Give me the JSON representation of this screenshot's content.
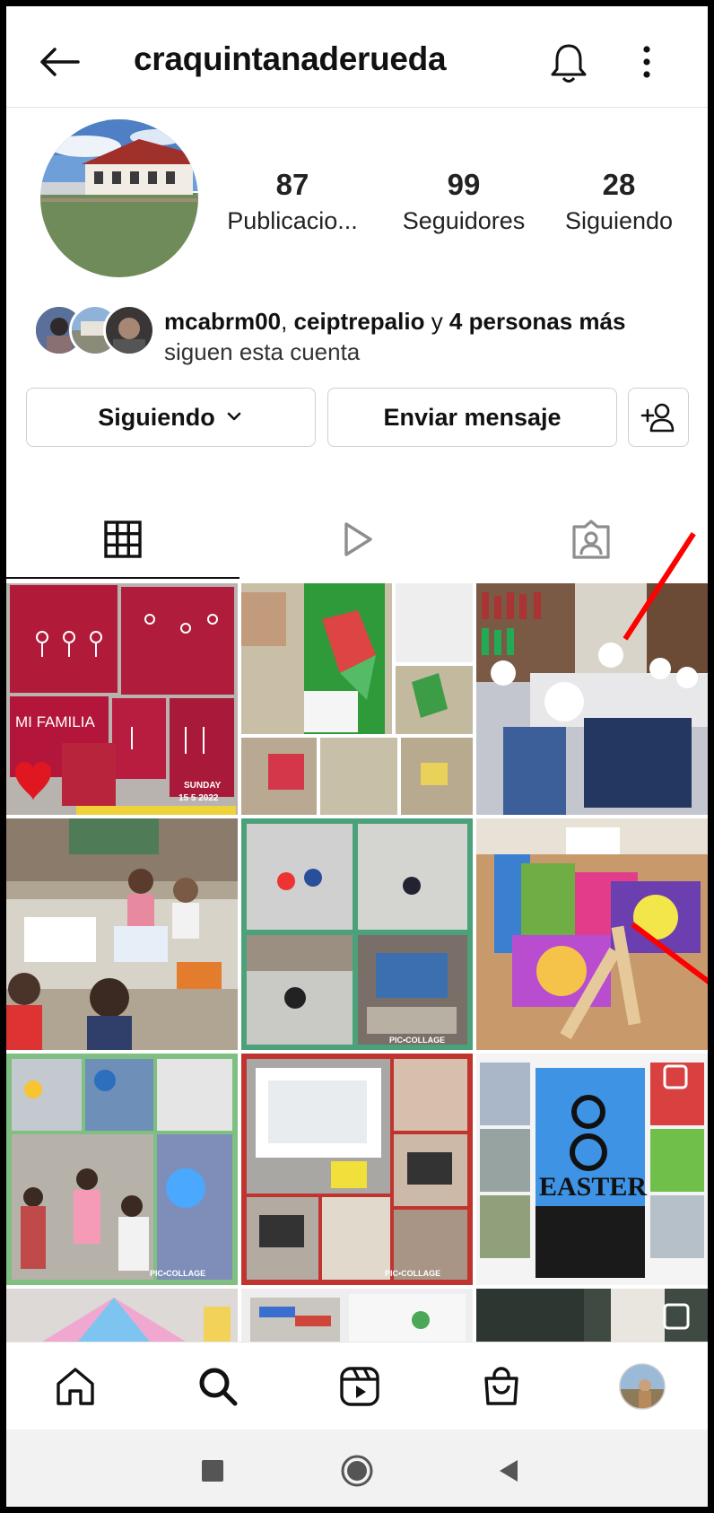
{
  "header": {
    "username": "craquintanaderueda",
    "back_icon": "arrow-left-icon",
    "bell_icon": "bell-icon",
    "more_icon": "more-vertical-icon"
  },
  "stats": [
    {
      "value": "87",
      "label": "Publicacio..."
    },
    {
      "value": "99",
      "label": "Seguidores"
    },
    {
      "value": "28",
      "label": "Siguiendo"
    }
  ],
  "followed_by": {
    "user1": "mcabrm00",
    "comma": ", ",
    "user2": "ceiptrepalio",
    "conj": " y ",
    "others": "4 personas más",
    "line2": "siguen esta cuenta"
  },
  "actions": {
    "following": "Siguiendo",
    "message": "Enviar mensaje"
  },
  "tabs": [
    "posts-grid-icon",
    "reels-play-icon",
    "tagged-person-icon"
  ],
  "grid_captions": {
    "p1_title": "MI FAMILIA",
    "p1_date1": "SUNDAY",
    "p1_date2": "15 5 2022",
    "p5_tag": "PIC•COLLAGE",
    "p7_tag": "PIC•COLLAGE",
    "p8_tag": "PIC•COLLAGE",
    "p9_word": "EASTER"
  },
  "nav": [
    "home-icon",
    "search-icon",
    "reels-icon",
    "shop-icon",
    "profile-avatar"
  ],
  "colors": {
    "accent_line": "#ff0000",
    "text": "#111111",
    "border": "#d0d0d0"
  }
}
